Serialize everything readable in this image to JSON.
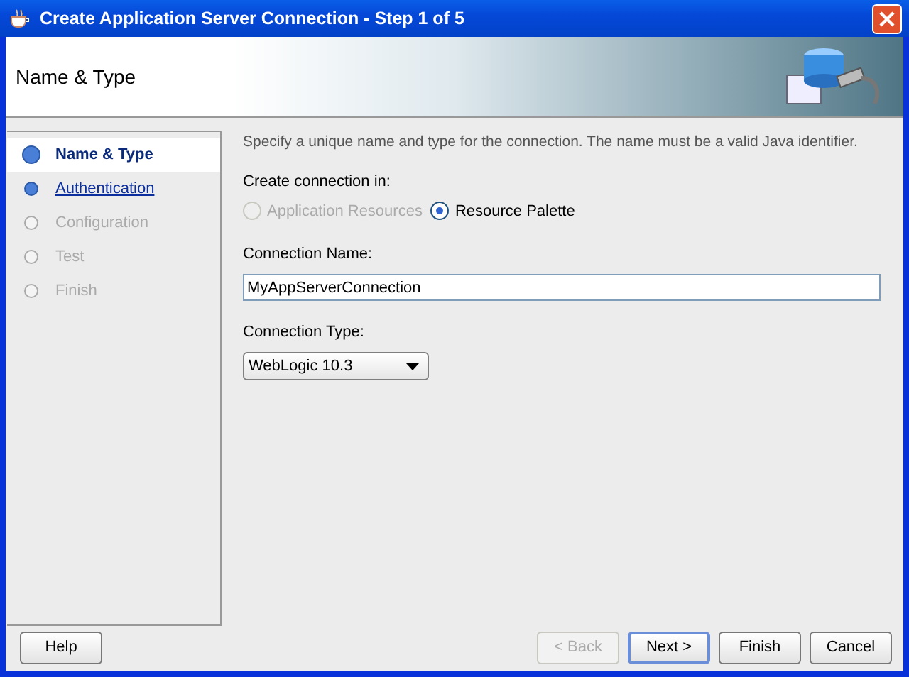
{
  "window": {
    "title": "Create Application Server Connection - Step 1 of 5"
  },
  "header": {
    "title": "Name & Type"
  },
  "steps": [
    {
      "label": "Name & Type",
      "selected": true,
      "disabled": false
    },
    {
      "label": "Authentication",
      "selected": false,
      "disabled": false
    },
    {
      "label": "Configuration",
      "selected": false,
      "disabled": true
    },
    {
      "label": "Test",
      "selected": false,
      "disabled": true
    },
    {
      "label": "Finish",
      "selected": false,
      "disabled": true
    }
  ],
  "instructions": "Specify a unique name and type for the connection. The name must be a valid Java identifier.",
  "location": {
    "label": "Create connection in:",
    "options": [
      {
        "label": "Application Resources",
        "selected": false,
        "disabled": true
      },
      {
        "label": "Resource Palette",
        "selected": true,
        "disabled": false
      }
    ]
  },
  "connection_name": {
    "label": "Connection Name:",
    "value": "MyAppServerConnection"
  },
  "connection_type": {
    "label": "Connection Type:",
    "value": "WebLogic 10.3"
  },
  "buttons": [
    {
      "label": "Help",
      "disabled": false,
      "default": false
    },
    {
      "label": "< Back",
      "disabled": true,
      "default": false
    },
    {
      "label": "Next >",
      "disabled": false,
      "default": true
    },
    {
      "label": "Finish",
      "disabled": false,
      "default": false
    },
    {
      "label": "Cancel",
      "disabled": false,
      "default": false
    }
  ]
}
